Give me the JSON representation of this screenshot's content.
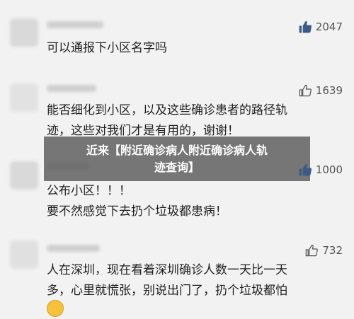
{
  "comments": [
    {
      "likes": "2047",
      "lines": [
        "可以通报下小区名字吗"
      ],
      "liked": true
    },
    {
      "likes": "1639",
      "lines": [
        "能否细化到小区，以及这些确诊患者的路径轨",
        "迹，这些对我们才是有用的，谢谢！"
      ],
      "liked": false
    },
    {
      "likes": "1000",
      "lines": [
        "公布小区！！！",
        "要不然感觉下去扔个垃圾都患病！"
      ],
      "liked": true
    },
    {
      "likes": "732",
      "lines": [
        "人在深圳，现在看着深圳确诊人数一天比一天",
        "多，心里就慌张，别说出门了，扔个垃圾都怕"
      ],
      "liked": false
    }
  ],
  "overlay": {
    "line1": "近来【附近确诊病人附近确诊病人轨",
    "line2": "迹查询】"
  },
  "colors": {
    "background": "#f2f2f2",
    "like_filled": "#3b5b86",
    "overlay": "#5a5a5a"
  },
  "icons": {
    "like": "thumbs-up-icon",
    "emoji": "fearful-face-emoji-icon"
  }
}
